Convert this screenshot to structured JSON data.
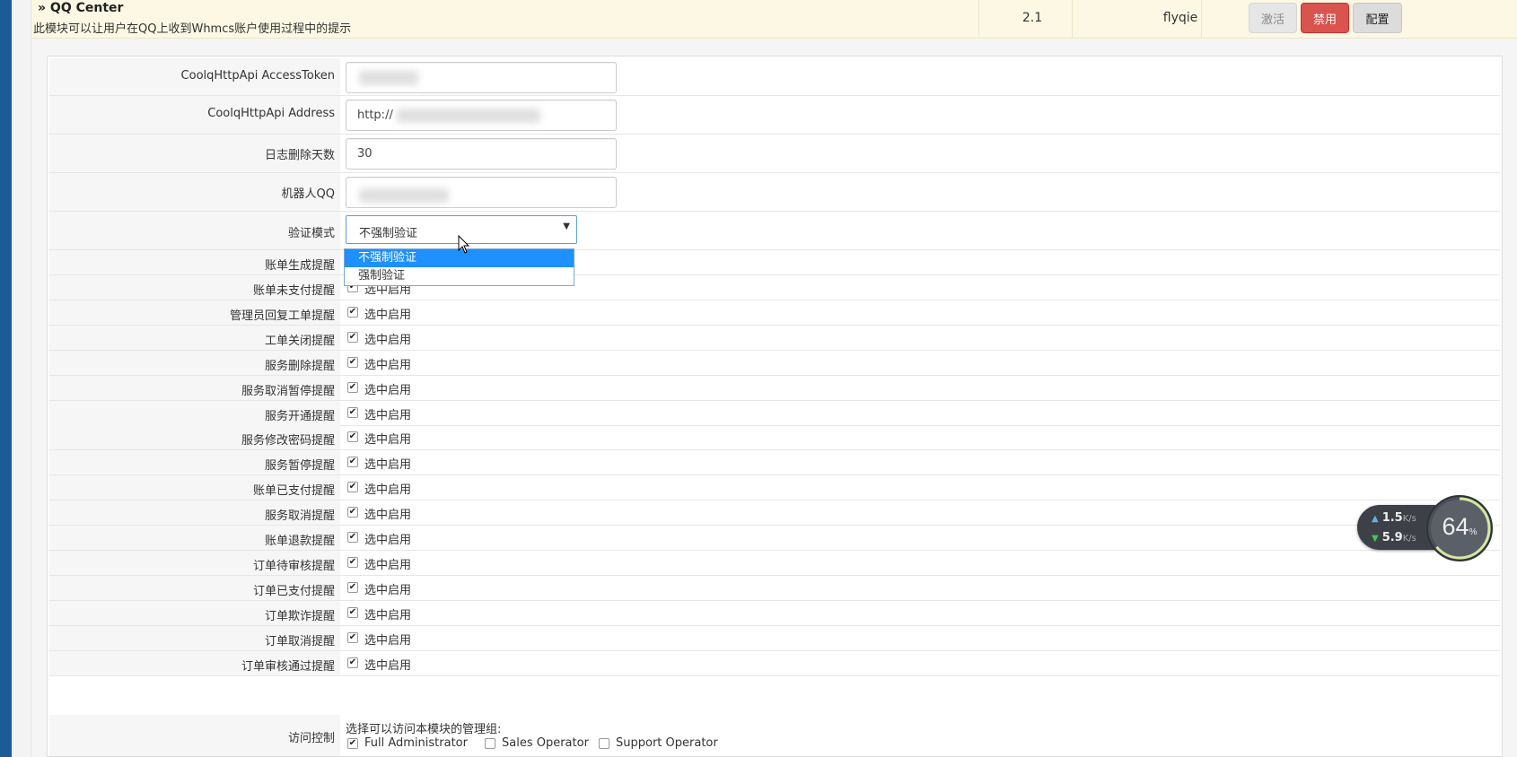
{
  "module": {
    "title": "» QQ Center",
    "description": "此模块可以让用户在QQ上收到Whmcs账户使用过程中的提示",
    "version": "2.1",
    "author": "flyqie",
    "buttons": {
      "activate": "激活",
      "disable": "禁用",
      "config": "配置"
    }
  },
  "config": {
    "fields": [
      {
        "label": "CoolqHttpApi AccessToken",
        "value": ""
      },
      {
        "label": "CoolqHttpApi Address",
        "value": "http://"
      },
      {
        "label": "日志删除天数",
        "value": "30"
      },
      {
        "label": "机器人QQ",
        "value": ""
      }
    ],
    "verify": {
      "label": "验证模式",
      "selected": "不强制验证",
      "options": [
        "不强制验证",
        "强制验证"
      ]
    },
    "checkbox_text": "选中启用",
    "notifications": [
      "账单生成提醒",
      "账单未支付提醒",
      "管理员回复工单提醒",
      "工单关闭提醒",
      "服务删除提醒",
      "服务取消暂停提醒",
      "服务开通提醒",
      "服务修改密码提醒",
      "服务暂停提醒",
      "账单已支付提醒",
      "服务取消提醒",
      "账单退款提醒",
      "订单待审核提醒",
      "订单已支付提醒",
      "订单欺诈提醒",
      "订单取消提醒",
      "订单审核通过提醒"
    ],
    "access": {
      "label": "访问控制",
      "hint": "选择可以访问本模块的管理组:",
      "groups": [
        {
          "name": "Full Administrator",
          "checked": true
        },
        {
          "name": "Sales Operator",
          "checked": false
        },
        {
          "name": "Support Operator",
          "checked": false
        }
      ]
    }
  },
  "network_widget": {
    "upload": "1.5",
    "download": "5.9",
    "unit": "K/s",
    "percent": "64",
    "percent_sign": "%"
  },
  "colors": {
    "sidebar": "#1c5c96",
    "danger": "#d9534f",
    "select_highlight": "#1e90ff"
  }
}
